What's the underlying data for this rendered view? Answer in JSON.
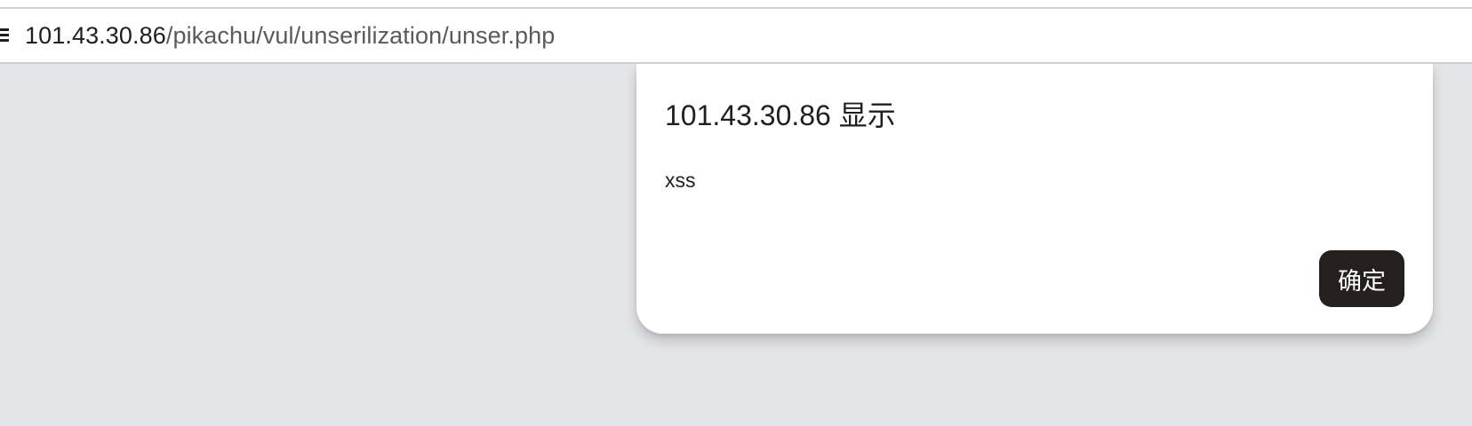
{
  "address_bar": {
    "url_host": "101.43.30.86",
    "url_path": "/pikachu/vul/unserilization/unser.php",
    "site_icon": "site-info-icon"
  },
  "dialog": {
    "title": "101.43.30.86 显示",
    "message": "xss",
    "ok_label": "确定",
    "ok_button_color": "#25201d"
  },
  "colors": {
    "page_background": "#e4e5e9",
    "dialog_background": "#ffffff"
  }
}
